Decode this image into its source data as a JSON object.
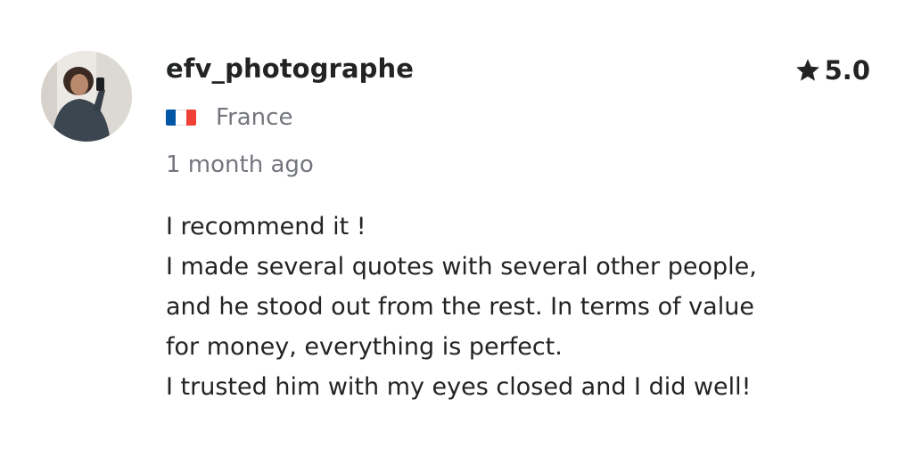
{
  "reviewer": {
    "username": "efv_photographe",
    "country": "France",
    "country_flag_icon": "flag-france-icon",
    "flag_colors": [
      "#0055a4",
      "#ffffff",
      "#ef4135"
    ],
    "avatar_icon": "user-avatar-photo"
  },
  "rating": {
    "icon": "star-icon",
    "value": "5.0"
  },
  "time_ago": "1 month ago",
  "review": {
    "lines": [
      "I recommend it !",
      "I made several quotes with several other people,",
      "and he stood out from the rest. In terms of value",
      "for money, everything is perfect.",
      "I trusted him with my eyes closed and I did well!"
    ]
  }
}
